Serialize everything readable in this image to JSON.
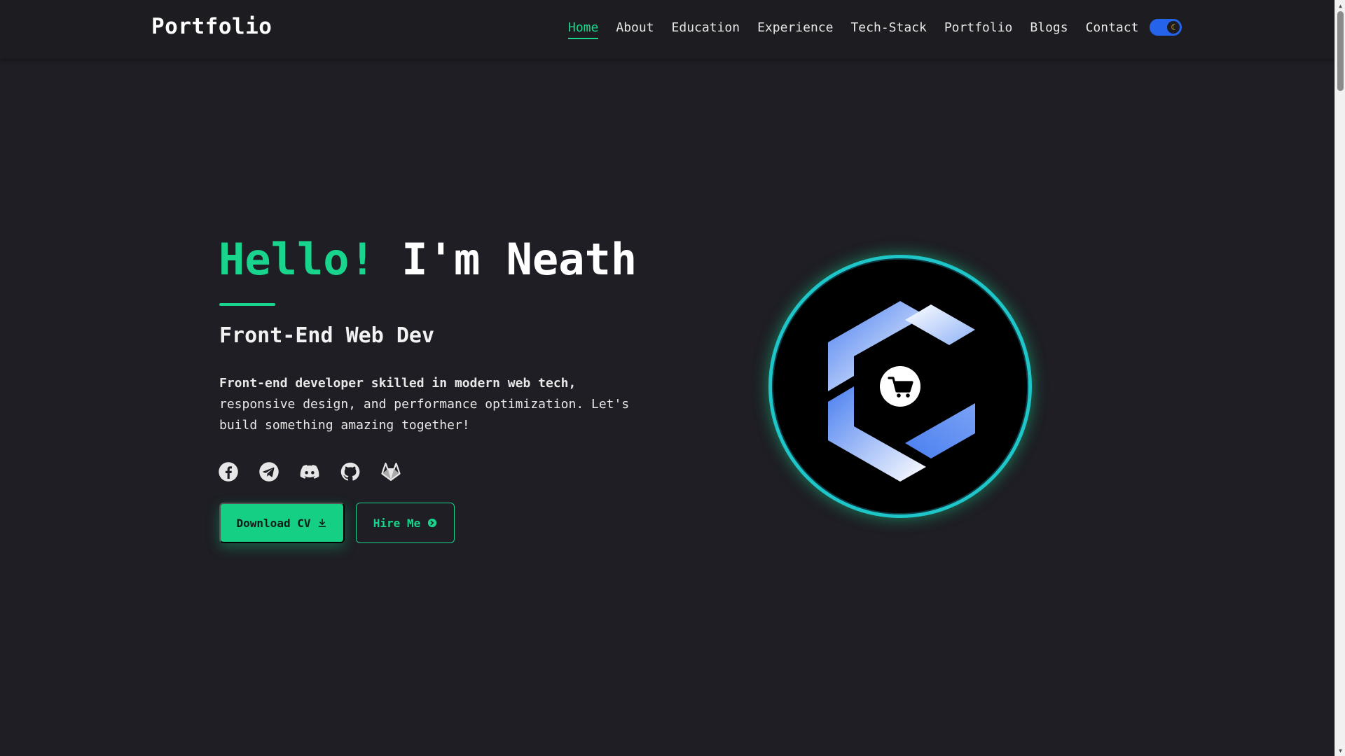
{
  "brand": "Portfolio",
  "nav": {
    "items": [
      {
        "label": "Home",
        "active": true
      },
      {
        "label": "About",
        "active": false
      },
      {
        "label": "Education",
        "active": false
      },
      {
        "label": "Experience",
        "active": false
      },
      {
        "label": "Tech-Stack",
        "active": false
      },
      {
        "label": "Portfolio",
        "active": false
      },
      {
        "label": "Blogs",
        "active": false
      },
      {
        "label": "Contact",
        "active": false
      }
    ],
    "theme_toggle": {
      "state": "dark",
      "icon": "moon-icon"
    }
  },
  "hero": {
    "greeting": "Hello!",
    "name_line": "I'm Neath",
    "subtitle": "Front-End Web Dev",
    "description_lead": "Front-end developer skilled in modern web tech,",
    "description_rest": "responsive design, and performance optimization. Let's build something amazing together!",
    "socials": [
      {
        "name": "facebook-icon"
      },
      {
        "name": "telegram-icon"
      },
      {
        "name": "discord-icon"
      },
      {
        "name": "github-icon"
      },
      {
        "name": "gitlab-icon"
      }
    ],
    "buttons": {
      "download_label": "Download CV",
      "download_icon": "download-icon",
      "hire_label": "Hire Me",
      "hire_icon": "arrow-circle-icon"
    }
  },
  "logo": {
    "icon": "shopping-cart-icon"
  },
  "colors": {
    "accent": "#18d48c",
    "background": "#1e1e24",
    "navbar": "#1c1c21",
    "toggle": "#2563eb",
    "logo_ring": "#1ec6c9",
    "logo_blue": "#4a7ff0"
  }
}
